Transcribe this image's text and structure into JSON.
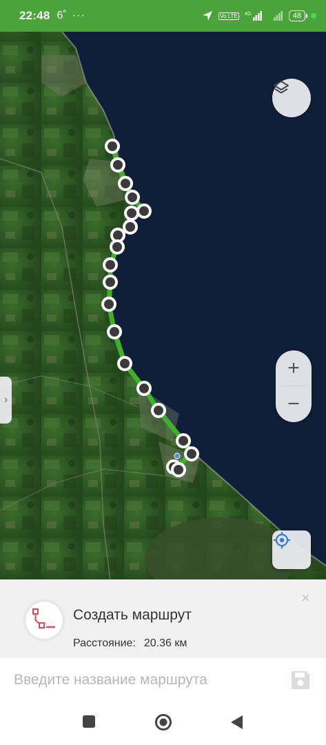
{
  "status_bar": {
    "time": "22:48",
    "temperature": "6˚",
    "dots": "···",
    "network_tag": "Vo LTE",
    "signal_tag": "4G",
    "battery": "48"
  },
  "map": {
    "type": "satellite",
    "route_color": "#3fb02a",
    "waypoint_count": 22,
    "controls": {
      "layers": "layers-icon",
      "zoom_in": "+",
      "zoom_out": "−",
      "locate": "crosshair-icon",
      "side_handle": "›"
    }
  },
  "route_panel": {
    "title": "Создать маршрут",
    "distance_label": "Расстояние:",
    "distance_value": "20.36 км",
    "close": "×",
    "icon": "route-icon"
  },
  "route_name": {
    "placeholder": "Введите название маршрута",
    "value": "",
    "save_icon": "floppy-disk-icon"
  },
  "nav_bar": {
    "recents": "square-icon",
    "home": "circle-icon",
    "back": "triangle-icon"
  },
  "colors": {
    "status_bar": "#4aa43a",
    "sea": "#0f1f3a",
    "land": "#2f5a26",
    "route_icon": "#e0475a"
  }
}
